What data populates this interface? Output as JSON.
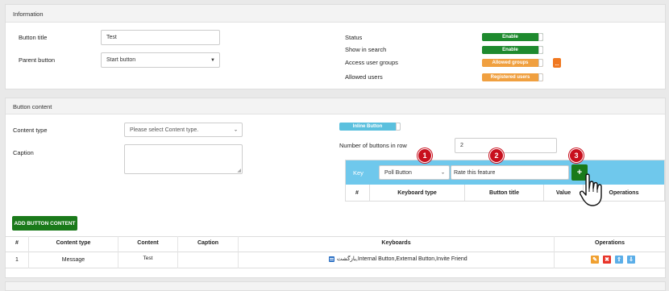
{
  "information": {
    "header": "Information",
    "button_title_label": "Button title",
    "button_title_value": "Test",
    "parent_button_label": "Parent button",
    "parent_button_value": "Start button",
    "status_label": "Status",
    "status_value": "Enable",
    "show_in_search_label": "Show in search",
    "show_in_search_value": "Enable",
    "access_groups_label": "Access user groups",
    "access_groups_value": "Allowed groups",
    "access_groups_button": "...",
    "allowed_users_label": "Allowed users",
    "allowed_users_value": "Registered users"
  },
  "button_content": {
    "header": "Button content",
    "content_type_label": "Content type",
    "content_type_placeholder": "Please select Content type.",
    "caption_label": "Caption",
    "inline_button_label": "Inline Button",
    "buttons_in_row_label": "Number of buttons in row",
    "buttons_in_row_value": "2",
    "key_label": "Key",
    "keyboard_type_value": "Poll Button",
    "button_title_value": "Rate this feature",
    "add_key_label": "+",
    "key_table_headers": [
      "#",
      "Keyboard type",
      "Button title",
      "Value",
      "Operations"
    ],
    "callouts": [
      "1",
      "2",
      "3"
    ],
    "add_content_label": "ADD BUTTON CONTENT"
  },
  "content_table": {
    "headers": [
      "#",
      "Content type",
      "Content",
      "Caption",
      "Keyboards",
      "Operations"
    ],
    "rows": [
      {
        "index": "1",
        "content_type": "Message",
        "content": "Test",
        "caption": "",
        "keyboards": "بازگشت,Internal Button,External Button,Invite Friend"
      }
    ]
  },
  "colors": {
    "enable_green": "#1e8a2e",
    "orange": "#f0a040",
    "inline_blue": "#5bc0de",
    "key_panel_blue": "#6fc8ec",
    "add_green": "#1a7a1a",
    "callout_red": "#c8101e",
    "edit_orange": "#f0a030",
    "delete_red": "#e8352a",
    "move_blue": "#5baee8"
  }
}
